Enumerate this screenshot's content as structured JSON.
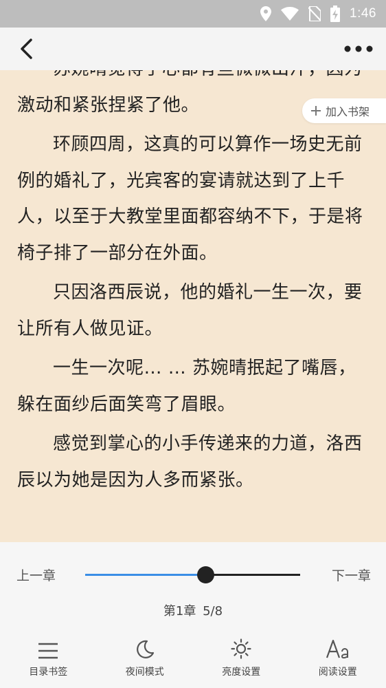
{
  "status_bar": {
    "time": "1:46",
    "icons": [
      "location-icon",
      "wifi-icon",
      "no-sim-icon",
      "battery-charging-icon"
    ]
  },
  "top_bar": {
    "back_icon": "chevron-left-icon",
    "more_icon": "more-horizontal-icon"
  },
  "reader": {
    "add_to_shelf_label": "加入书架",
    "paragraphs": [
      {
        "text": "苏婉晴觉得手心都有些微微出汗，因为激动和紧张捏紧了他。",
        "indent": true
      },
      {
        "text": "环顾四周，这真的可以算作一场史无前例的婚礼了，光宾客的宴请就达到了上千人，以至于大教堂里面都容纳不下，于是将椅子排了一部分在外面。",
        "indent": true
      },
      {
        "text": "只因洛西辰说，他的婚礼一生一次，要让所有人做见证。",
        "indent": true
      },
      {
        "text": "一生一次呢… … 苏婉晴抿起了嘴唇，躲在面纱后面笑弯了眉眼。",
        "indent": true
      },
      {
        "text": "感觉到掌心的小手传递来的力道，洛西辰以为她是因为人多而紧张。",
        "indent": true
      }
    ]
  },
  "bottom_panel": {
    "prev_chapter": "上一章",
    "next_chapter": "下一章",
    "progress_fraction": 0.56,
    "accent_color": "#3a8ee6",
    "chapter_label": "第1章",
    "page_label": "5/8",
    "toolbar": [
      {
        "label": "目录书签",
        "icon": "menu-icon"
      },
      {
        "label": "夜间模式",
        "icon": "moon-icon"
      },
      {
        "label": "亮度设置",
        "icon": "sun-icon"
      },
      {
        "label": "阅读设置",
        "icon": "font-size-icon"
      }
    ]
  }
}
